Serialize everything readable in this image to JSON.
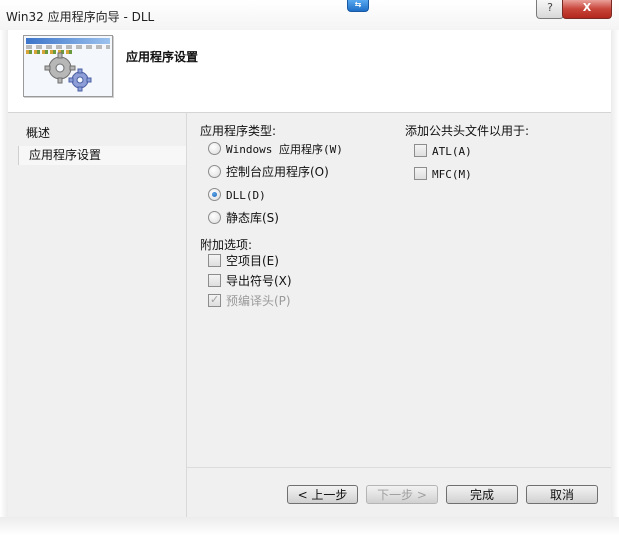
{
  "window": {
    "title": "Win32 应用程序向导 - DLL",
    "badge_icon": "transfer-badge-icon",
    "help_label": "?",
    "close_label": "X"
  },
  "header": {
    "title": "应用程序设置",
    "icon": "gears-icon"
  },
  "nav": {
    "items": [
      {
        "label": "概述"
      },
      {
        "label": "应用程序设置"
      }
    ]
  },
  "app_type": {
    "label": "应用程序类型:",
    "options": [
      {
        "label": "Windows 应用程序(W)",
        "checked": false
      },
      {
        "label": "控制台应用程序(O)",
        "checked": false
      },
      {
        "label": "DLL(D)",
        "checked": true
      },
      {
        "label": "静态库(S)",
        "checked": false
      }
    ]
  },
  "extra_options": {
    "label": "附加选项:",
    "options": [
      {
        "label": "空项目(E)",
        "checked": false,
        "enabled": true
      },
      {
        "label": "导出符号(X)",
        "checked": false,
        "enabled": true
      },
      {
        "label": "预编译头(P)",
        "checked": true,
        "enabled": false
      }
    ]
  },
  "common_headers": {
    "label": "添加公共头文件以用于:",
    "options": [
      {
        "label": "ATL(A)",
        "checked": false
      },
      {
        "label": "MFC(M)",
        "checked": false
      }
    ]
  },
  "buttons": {
    "prev": "< 上一步",
    "next": "下一步 >",
    "finish": "完成",
    "cancel": "取消"
  },
  "colors": {
    "accent": "#1b5fb5",
    "close": "#c8453a"
  }
}
